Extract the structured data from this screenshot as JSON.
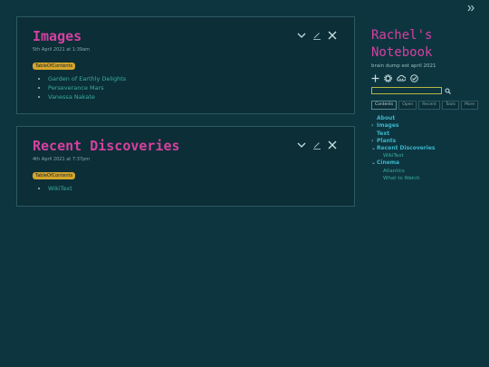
{
  "sidebar": {
    "title": "Rachel's Notebook",
    "subtitle": "brain dump est april 2021",
    "search_placeholder": "",
    "tabs": [
      "Contents",
      "Open",
      "Recent",
      "Tools",
      "More"
    ],
    "toc": [
      {
        "label": "About",
        "chevron": ""
      },
      {
        "label": "Images",
        "chevron": "›"
      },
      {
        "label": "Text",
        "chevron": ""
      },
      {
        "label": "Plants",
        "chevron": "›"
      },
      {
        "label": "Recent Discoveries",
        "chevron": "⌄",
        "children": [
          "WikiText"
        ]
      },
      {
        "label": "Cinema",
        "chevron": "⌄",
        "children": [
          "Atlantics",
          "What to Watch"
        ]
      }
    ]
  },
  "tiddlers": [
    {
      "title": "Images",
      "subtitle": "5th April 2021 at 1:39am",
      "tag": "TableOfContents",
      "items": [
        "Garden of Earthly Delights",
        "Perseverance Mars",
        "Vanessa Nakate"
      ]
    },
    {
      "title": "Recent Discoveries",
      "subtitle": "4th April 2021 at 7:37pm",
      "tag": "TableOfContents",
      "items": [
        "WikiText"
      ]
    }
  ],
  "icons": {
    "sidebar_toggle": "double-chevron-right-icon",
    "fold": "chevron-down-icon",
    "edit": "pencil-icon",
    "close": "close-icon",
    "new": "plus-icon",
    "settings": "gear-icon",
    "cloud": "cloud-icon",
    "save": "check-circle-icon",
    "search": "search-icon"
  },
  "colors": {
    "background": "#0d3540",
    "title_pink": "#d6409f",
    "tag_yellow": "#d3a52a",
    "link_teal": "#3aaea0"
  }
}
